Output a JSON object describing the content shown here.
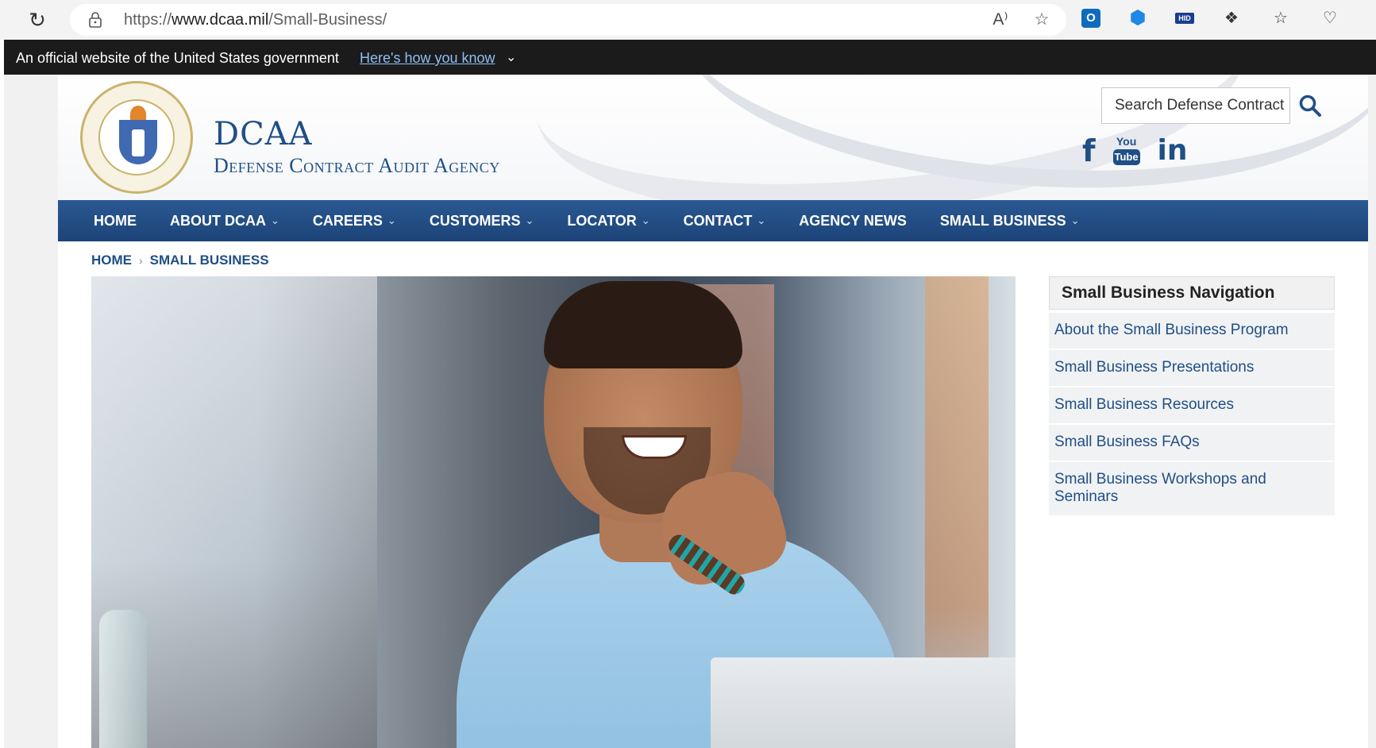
{
  "browser": {
    "url_prefix": "https://",
    "url_domain": "www.dcaa.mil",
    "url_path": "/Small-Business/"
  },
  "gov_banner": {
    "text": "An official website of the United States government",
    "link": "Here's how you know"
  },
  "header": {
    "title": "DCAA",
    "subtitle": "Defense Contract Audit Agency",
    "search_placeholder": "Search Defense Contract"
  },
  "nav": {
    "items": [
      {
        "label": "HOME",
        "has_dropdown": false
      },
      {
        "label": "ABOUT DCAA",
        "has_dropdown": true
      },
      {
        "label": "CAREERS",
        "has_dropdown": true
      },
      {
        "label": "CUSTOMERS",
        "has_dropdown": true
      },
      {
        "label": "LOCATOR",
        "has_dropdown": true
      },
      {
        "label": "CONTACT",
        "has_dropdown": true
      },
      {
        "label": "AGENCY NEWS",
        "has_dropdown": false
      },
      {
        "label": "SMALL BUSINESS",
        "has_dropdown": true
      }
    ]
  },
  "breadcrumb": {
    "home": "HOME",
    "current": "SMALL BUSINESS"
  },
  "sidenav": {
    "title": "Small Business Navigation",
    "items": [
      "About the Small Business Program",
      "Small Business Presentations",
      "Small Business Resources",
      "Small Business FAQs",
      "Small Business Workshops and Seminars"
    ]
  },
  "colors": {
    "nav_blue": "#1f4f86",
    "gov_banner_bg": "#1b1b1b",
    "link_blue": "#1f4f86"
  },
  "icons": {
    "social": [
      "facebook-icon",
      "youtube-icon",
      "linkedin-icon"
    ]
  }
}
